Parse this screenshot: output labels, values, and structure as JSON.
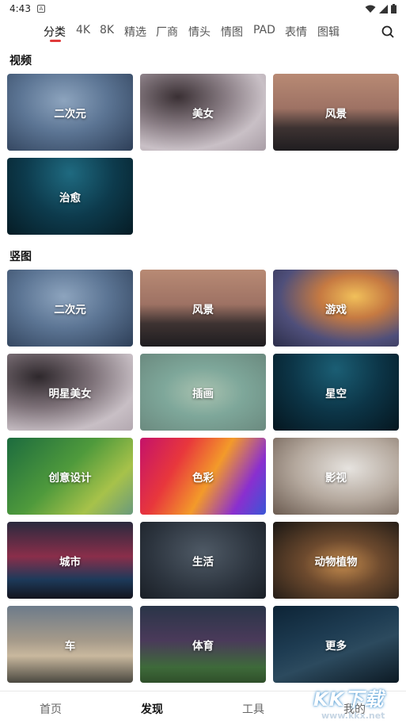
{
  "status_bar": {
    "time": "4:43",
    "app_icon_letter": "A"
  },
  "tabs": [
    {
      "label": "分类",
      "active": true
    },
    {
      "label": "4K"
    },
    {
      "label": "8K"
    },
    {
      "label": "精选"
    },
    {
      "label": "厂商"
    },
    {
      "label": "情头"
    },
    {
      "label": "情图"
    },
    {
      "label": "PAD"
    },
    {
      "label": "表情"
    },
    {
      "label": "图辑"
    }
  ],
  "sections": {
    "video": {
      "title": "视频",
      "items": [
        "二次元",
        "美女",
        "风景",
        "治愈"
      ]
    },
    "vertical": {
      "title": "竖图",
      "items": [
        "二次元",
        "风景",
        "游戏",
        "明星美女",
        "插画",
        "星空",
        "创意设计",
        "色彩",
        "影视",
        "城市",
        "生活",
        "动物植物",
        "车",
        "体育",
        "更多"
      ]
    }
  },
  "bottom_nav": [
    {
      "label": "首页"
    },
    {
      "label": "发现",
      "active": true
    },
    {
      "label": "工具"
    },
    {
      "label": "我的"
    }
  ],
  "watermark": {
    "text": "KK下载",
    "url": "www.kkx.net"
  },
  "colors": {
    "accent": "#e03a3a"
  }
}
